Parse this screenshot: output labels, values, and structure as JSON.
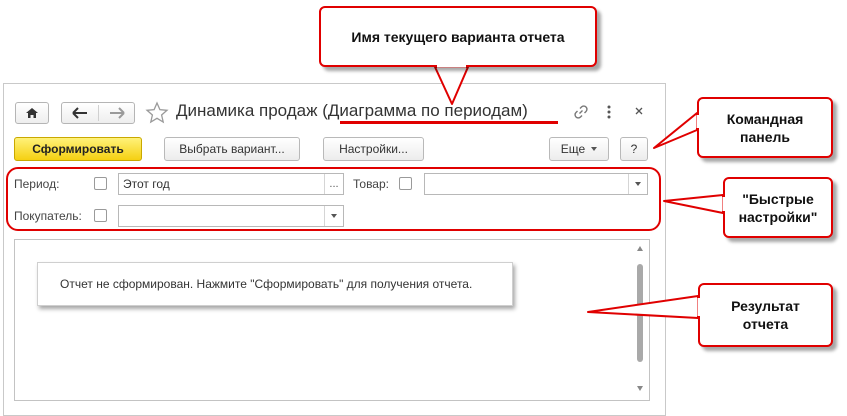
{
  "window": {
    "title_prefix": "Динамика продаж (",
    "title_variant": "Диаграмма по периодам",
    "title_suffix": ")"
  },
  "toolbar": {
    "generate_label": "Сформировать",
    "choose_variant_label": "Выбрать вариант...",
    "settings_label": "Настройки...",
    "more_label": "Еще",
    "help_label": "?"
  },
  "quick_settings": {
    "period_label": "Период:",
    "period_value": "Этот год",
    "period_choose": "...",
    "product_label": "Товар:",
    "product_value": "",
    "buyer_label": "Покупатель:",
    "buyer_value": ""
  },
  "report": {
    "message": "Отчет не сформирован. Нажмите \"Сформировать\" для получения отчета."
  },
  "callouts": {
    "variant_name": "Имя текущего варианта отчета",
    "command_panel": "Командная панель",
    "quick_settings": "\"Быстрые настройки\"",
    "report_result": "Результат отчета"
  },
  "colors": {
    "accent_red": "#e00000",
    "primary_button": "#f5d012"
  }
}
